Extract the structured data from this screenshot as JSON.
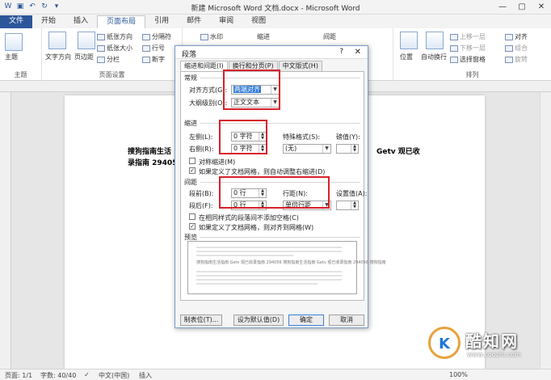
{
  "window": {
    "title": "新建 Microsoft Word 文档.docx - Microsoft Word",
    "controls": [
      "—",
      "▢",
      "✕"
    ]
  },
  "tabs": [
    "文件",
    "开始",
    "插入",
    "页面布局",
    "引用",
    "邮件",
    "审阅",
    "视图"
  ],
  "ribbon": {
    "groups": {
      "theme": "主题",
      "page_setup": "页面设置",
      "arrange": "排列"
    },
    "buttons": {
      "theme": "主题",
      "text_direction": "文字方向",
      "margins": "页边距",
      "orientation": "纸张方向",
      "size": "纸张大小",
      "columns": "分栏",
      "breaks": "分隔符",
      "line_numbers": "行号",
      "hyphenation": "断字",
      "watermark": "水印",
      "indent": "缩进",
      "spacing": "间距",
      "position": "位置",
      "wrap_text": "自动换行",
      "bring_forward": "上移一层",
      "send_backward": "下移一层",
      "selection_pane": "选择窗格",
      "align": "对齐",
      "group": "组合",
      "rotate": "旋转"
    }
  },
  "document": {
    "line1_left": "搜狗指南生活",
    "line1_right": "Getv 观已收",
    "line2": "录指南 294056"
  },
  "dialog": {
    "title": "段落",
    "help": "?",
    "close": "✕",
    "tabs": [
      "缩进和间距(I)",
      "换行和分页(P)",
      "中文版式(H)"
    ],
    "general": {
      "header": "常规",
      "alignment_label": "对齐方式(G):",
      "alignment_value": "两端对齐",
      "outline_label": "大纲级别(O):",
      "outline_value": "正文文本"
    },
    "indent": {
      "header": "缩进",
      "left_label": "左侧(L):",
      "left_value": "0 字符",
      "right_label": "右侧(R):",
      "right_value": "0 字符",
      "special_label": "特殊格式(S):",
      "special_value": "(无)",
      "by_label": "磅值(Y):",
      "mirror": "对称缩进(M)",
      "auto_adjust": "如果定义了文档网格，则自动调整右缩进(D)"
    },
    "spacing": {
      "header": "间距",
      "before_label": "段前(B):",
      "before_value": "0 行",
      "after_label": "段后(F):",
      "after_value": "0 行",
      "line_label": "行距(N):",
      "line_value": "单倍行距",
      "at_label": "设置值(A):",
      "no_space": "在相同样式的段落间不添加空格(C)",
      "snap_grid": "如果定义了文档网格，则对齐到网格(W)"
    },
    "preview": {
      "header": "预览",
      "sample": "搜狗指南生活指南 Getv 观已收录指南 294056 搜狗指南生活指南 Getv 观已收录指南 294056 搜狗指南"
    },
    "buttons": {
      "tabs": "制表位(T)...",
      "default": "设为默认值(D)",
      "ok": "确定",
      "cancel": "取消"
    }
  },
  "statusbar": {
    "page": "页面: 1/1",
    "words": "字数: 40/40",
    "language": "中文(中国)",
    "mode": "插入",
    "zoom": "100%"
  },
  "watermark": {
    "name": "酷知网",
    "url": "www.coozhi.com"
  },
  "colors": {
    "accent": "#2b579a",
    "highlight_box": "#d8202a",
    "selection": "#3179d8"
  }
}
